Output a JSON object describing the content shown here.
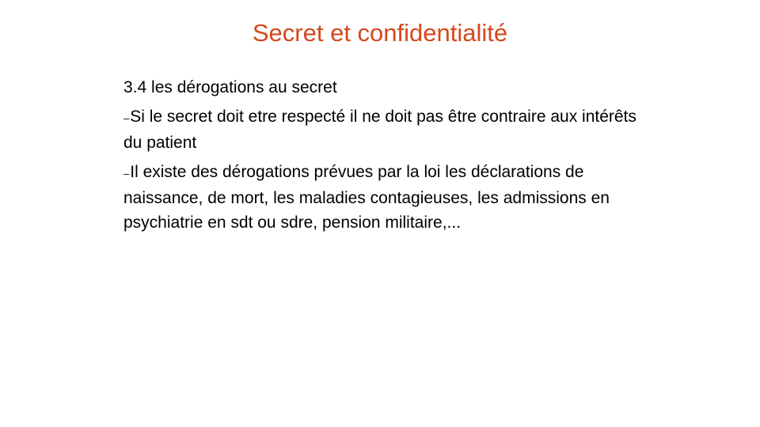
{
  "slide": {
    "title": "Secret et confidentialité",
    "heading": "3.4 les dérogations au secret",
    "bullets": [
      {
        "marker": "–",
        "text": "Si le secret doit etre respecté il ne doit pas être contraire aux intérêts du patient"
      },
      {
        "marker": "–",
        "text": "Il existe des dérogations prévues par la loi les déclarations de naissance, de mort, les maladies contagieuses, les admissions en psychiatrie en sdt ou sdre, pension militaire,..."
      }
    ],
    "colors": {
      "title": "#d4481d",
      "text": "#000000",
      "background": "#ffffff"
    }
  }
}
